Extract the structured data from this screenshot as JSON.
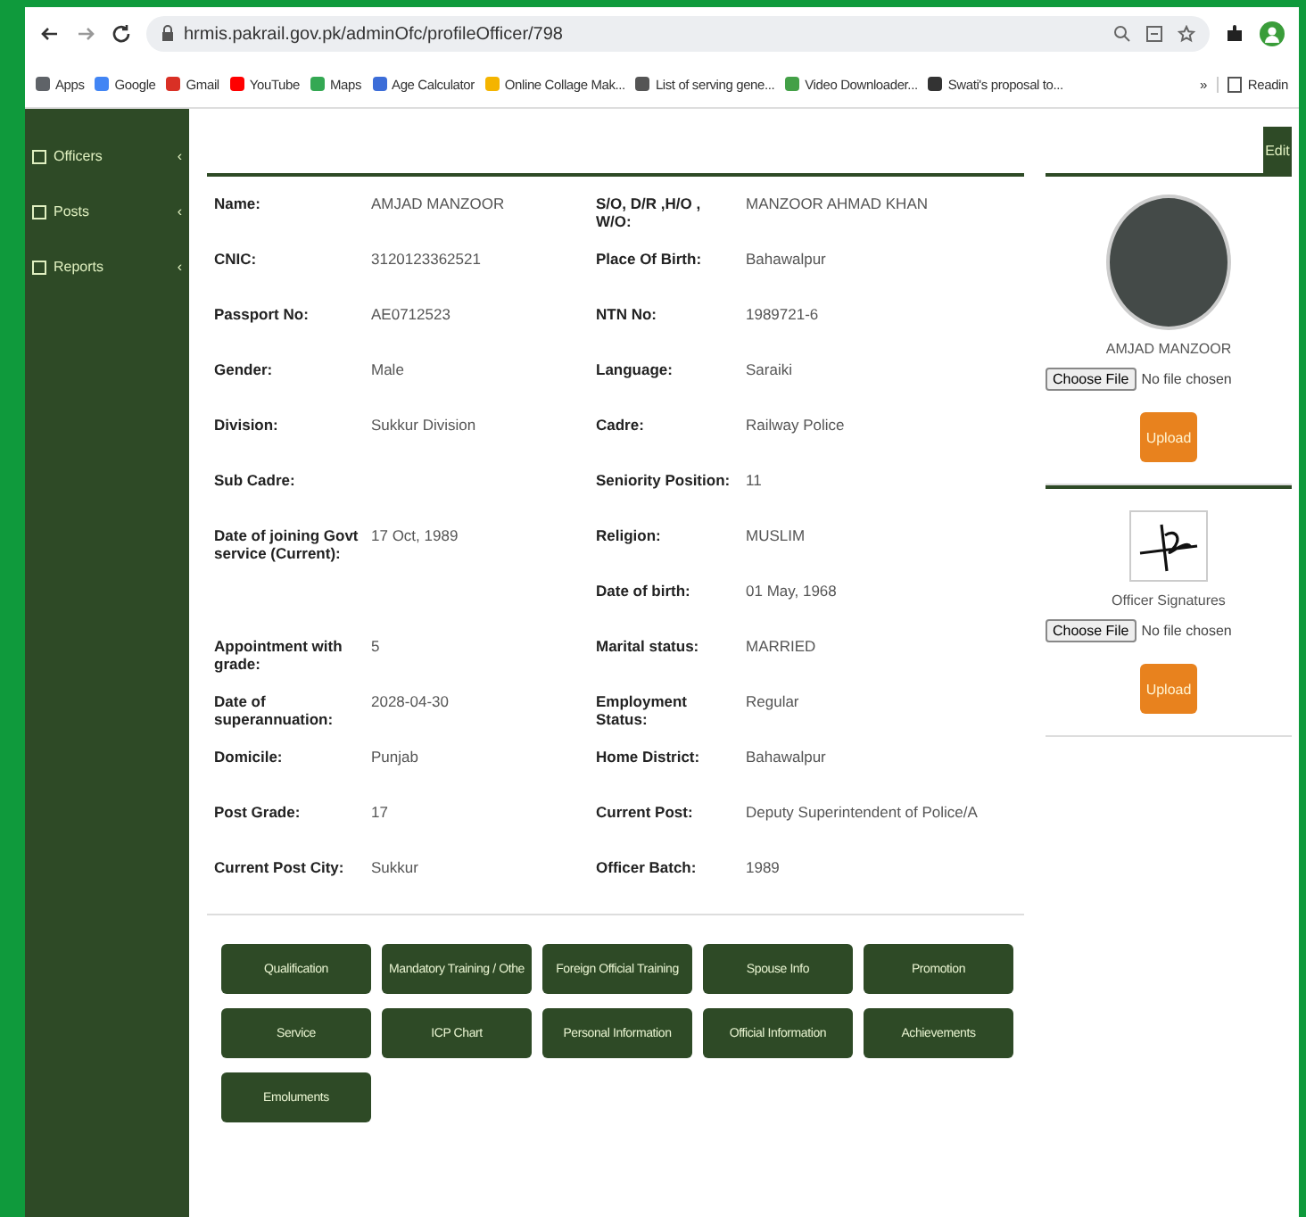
{
  "browser": {
    "url": "hrmis.pakrail.gov.pk/adminOfc/profileOfficer/798",
    "bookmarks": [
      "Apps",
      "Google",
      "Gmail",
      "YouTube",
      "Maps",
      "Age Calculator",
      "Online Collage Mak...",
      "List of serving gene...",
      "Video Downloader...",
      "Swati's proposal to..."
    ],
    "overflow": "»",
    "reading": "Readin"
  },
  "sidebar": {
    "items": [
      {
        "label": "Officers",
        "chevron": "‹"
      },
      {
        "label": "Posts",
        "chevron": "‹"
      },
      {
        "label": "Reports",
        "chevron": "‹"
      }
    ]
  },
  "edit_button": "Edit",
  "details": [
    {
      "left": {
        "label": "Name:",
        "value": "AMJAD MANZOOR"
      },
      "right": {
        "label": "S/O, D/R ,H/O , W/O:",
        "value": "MANZOOR AHMAD KHAN"
      }
    },
    {
      "left": {
        "label": "CNIC:",
        "value": "3120123362521"
      },
      "right": {
        "label": "Place Of Birth:",
        "value": "Bahawalpur"
      }
    },
    {
      "left": {
        "label": "Passport No:",
        "value": "AE0712523"
      },
      "right": {
        "label": "NTN No:",
        "value": "1989721-6"
      }
    },
    {
      "left": {
        "label": "Gender:",
        "value": "Male"
      },
      "right": {
        "label": "Language:",
        "value": "Saraiki"
      }
    },
    {
      "left": {
        "label": "Division:",
        "value": "Sukkur Division"
      },
      "right": {
        "label": "Cadre:",
        "value": "Railway Police"
      }
    },
    {
      "left": {
        "label": "Sub Cadre:"
      },
      "right": {
        "label": "Seniority Position:",
        "value": "11"
      }
    },
    {
      "left": {
        "label": "Date of joining Govt service (Current):",
        "value": "17 Oct, 1989"
      },
      "right": {
        "label": "Religion:",
        "value": "MUSLIM"
      }
    },
    {
      "right": {
        "label": "Date of birth:",
        "value": "01 May, 1968"
      }
    },
    {
      "left": {
        "label": "Appointment with grade:",
        "value": "5"
      },
      "right": {
        "label": "Marital status:",
        "value": "MARRIED"
      }
    },
    {
      "left": {
        "label": "Date of superannuation:",
        "value": "2028-04-30"
      },
      "right": {
        "label": "Employment Status:",
        "value": "Regular"
      }
    },
    {
      "left": {
        "label": "Domicile:",
        "value": "Punjab"
      },
      "right": {
        "label": "Home District:",
        "value": "Bahawalpur"
      }
    },
    {
      "left": {
        "label": "Post Grade:",
        "value": "17"
      },
      "right": {
        "label": "Current Post:",
        "value": "Deputy Superintendent of Police/A"
      }
    },
    {
      "left": {
        "label": "Current Post City:",
        "value": "Sukkur"
      },
      "right": {
        "label": "Officer Batch:",
        "value": "1989"
      }
    }
  ],
  "profile": {
    "name": "AMJAD MANZOOR",
    "choose_file": "Choose File",
    "no_file": "No file chosen",
    "upload": "Upload"
  },
  "signature": {
    "caption": "Officer Signatures",
    "choose_file": "Choose File",
    "no_file": "No file chosen",
    "upload": "Upload"
  },
  "buttons": [
    "Qualification",
    "Mandatory Training / Othe",
    "Foreign Official Training",
    "Spouse Info",
    "Promotion",
    "Service",
    "ICP Chart",
    "Personal Information",
    "Official Information",
    "Achievements",
    "Emoluments"
  ]
}
